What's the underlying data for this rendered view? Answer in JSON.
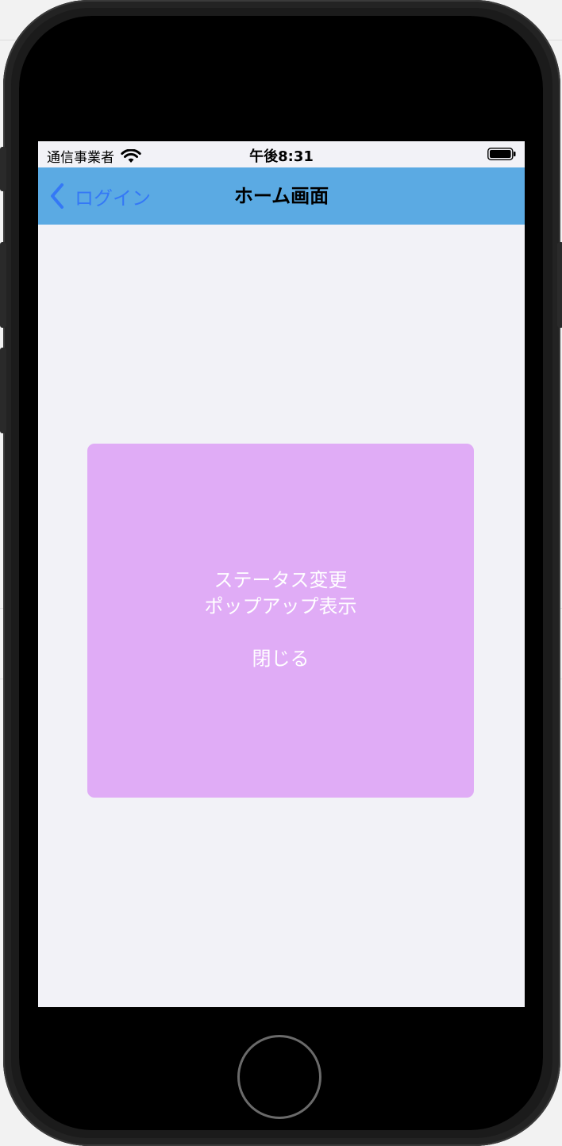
{
  "status_bar": {
    "carrier": "通信事業者",
    "time": "午後8:31",
    "wifi_icon": "wifi-icon",
    "battery_icon": "battery-full-icon"
  },
  "nav": {
    "back_label": "ログイン",
    "back_icon": "chevron-left-icon",
    "title": "ホーム画面",
    "bar_color": "#5baae3",
    "tint_color": "#3478f6"
  },
  "popup": {
    "line1": "ステータス変更",
    "line2": "ポップアップ表示",
    "close_label": "閉じる",
    "background_color": "#e0acf6"
  }
}
